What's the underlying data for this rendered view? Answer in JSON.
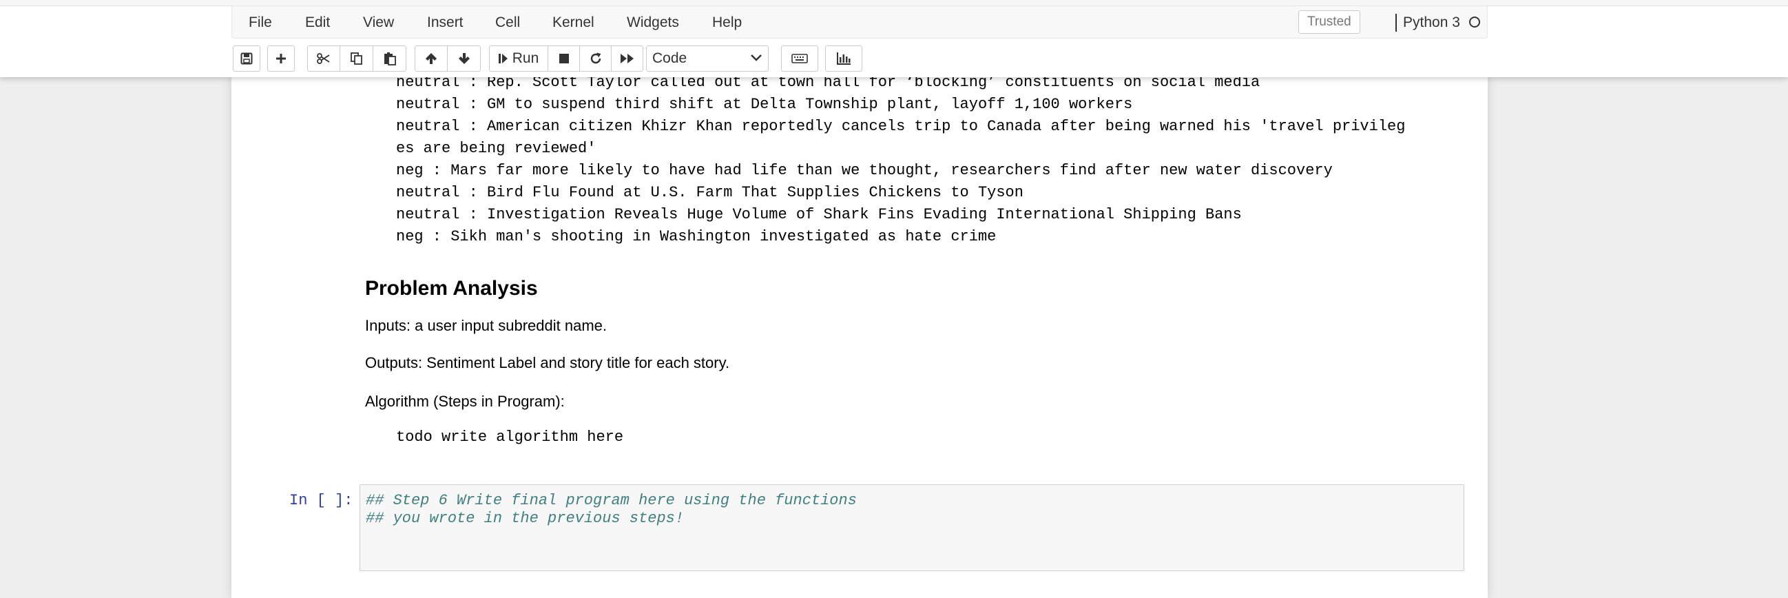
{
  "menubar": {
    "items": [
      "File",
      "Edit",
      "View",
      "Insert",
      "Cell",
      "Kernel",
      "Widgets",
      "Help"
    ],
    "trusted_label": "Trusted",
    "kernel_name": "Python 3"
  },
  "toolbar": {
    "buttons": [
      "save-icon",
      "plus-icon",
      "cut-icon",
      "copy-icon",
      "paste-icon",
      "arrow-up-icon",
      "arrow-down-icon",
      "run-icon",
      "stop-icon",
      "restart-icon",
      "fast-forward-icon",
      "keyboard-icon",
      "chart-icon"
    ],
    "run_label": "Run",
    "cell_type": "Code"
  },
  "output_lines": [
    "neutral : Rep. Scott Taylor called out at town hall for ‘blocking’ constituents on social media",
    "neutral : GM to suspend third shift at Delta Township plant, layoff 1,100 workers",
    "neutral : American citizen Khizr Khan reportedly cancels trip to Canada after being warned his 'travel privileg",
    "es are being reviewed'",
    "neg : Mars far more likely to have had life than we thought, researchers find after new water discovery",
    "neutral : Bird Flu Found at U.S. Farm That Supplies Chickens to Tyson",
    "neutral : Investigation Reveals Huge Volume of Shark Fins Evading International Shipping Bans",
    "neg : Sikh man's shooting in Washington investigated as hate crime"
  ],
  "markdown": {
    "heading": "Problem Analysis",
    "inputs": "Inputs: a user input subreddit name.",
    "outputs": "Outputs: Sentiment Label and story title for each story.",
    "algorithm": "Algorithm (Steps in Program):",
    "code": "todo write algorithm here"
  },
  "code_cell": {
    "prompt": "In [ ]:",
    "lines": [
      "## Step 6 Write final program here using the functions",
      "## you wrote in the previous steps!"
    ]
  },
  "colors": {
    "prompt_blue": "#303f9f",
    "comment_green": "#408080"
  }
}
